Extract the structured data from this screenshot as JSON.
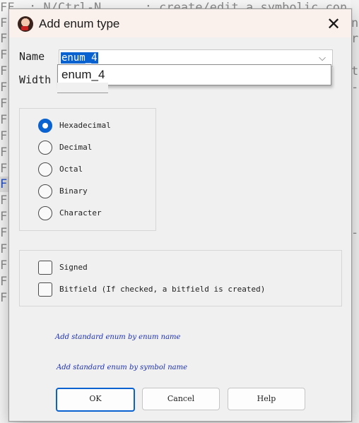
{
  "background_editor": {
    "lines": [
      "FF  : N/Ctrl-N      : create/edit a symbolic con",
      "FF",
      "FF",
      "FF",
      "FF",
      "FF",
      "FF",
      "FF",
      "FF",
      "FF",
      "FF",
      "FF",
      "FF",
      "FF",
      "FF",
      "FF",
      "FF",
      "FF",
      "FF"
    ],
    "right_glyphs": [
      "",
      "nt",
      "r",
      "",
      "th",
      "--",
      "",
      "",
      "",
      "",
      "",
      "",
      "",
      "",
      "--"
    ]
  },
  "dialog": {
    "title": "Add enum type",
    "close_glyph": "✕",
    "name_label": "Name",
    "name_value": "enum_4",
    "dropdown_item": "enum_4",
    "width_label": "Width",
    "radix_options": [
      {
        "label": "Hexadecimal",
        "checked": true
      },
      {
        "label": "Decimal",
        "checked": false
      },
      {
        "label": "Octal",
        "checked": false
      },
      {
        "label": "Binary",
        "checked": false
      },
      {
        "label": "Character",
        "checked": false
      }
    ],
    "checkboxes": [
      {
        "label": "Signed",
        "checked": false
      },
      {
        "label": "Bitfield (If checked, a bitfield is created)",
        "checked": false
      }
    ],
    "links": [
      "Add standard enum by enum name",
      "Add standard enum by symbol name"
    ],
    "buttons": {
      "ok": "OK",
      "cancel": "Cancel",
      "help": "Help"
    }
  }
}
